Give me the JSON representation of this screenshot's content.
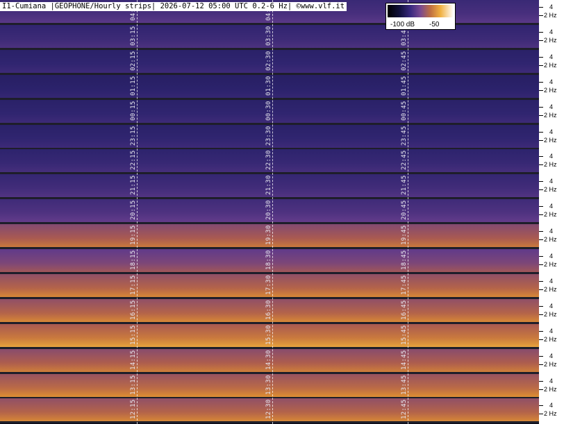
{
  "title": "I1-Cumiana |GEOPHONE/Hourly strips| 2026-07-12 05:00 UTC 0.2-6 Hz| ©www.vlf.it",
  "legend": {
    "min_label": "-100 dB",
    "max_label": "-50",
    "colormap": [
      "#000000",
      "#10103a",
      "#3a2a80",
      "#7a4a90",
      "#c07040",
      "#f0b040",
      "#ffffff"
    ]
  },
  "chart_data": {
    "type": "heatmap",
    "title": "I1-Cumiana |GEOPHONE/Hourly strips| 2026-07-12 05:00 UTC 0.2-6 Hz| ©www.vlf.it",
    "frequency_range_hz": [
      0.2,
      6
    ],
    "y_tick_labels": [
      "4",
      "2 Hz"
    ],
    "color_scale_db": [
      -100,
      -50
    ],
    "strips": [
      {
        "labels": [
          "04:1",
          "04:",
          "04:"
        ],
        "intensity": 0.35
      },
      {
        "labels": [
          "03:15",
          "03:30",
          "03:45"
        ],
        "intensity": 0.3
      },
      {
        "labels": [
          "02:15",
          "02:30",
          "02:45"
        ],
        "intensity": 0.25
      },
      {
        "labels": [
          "01:15",
          "01:30",
          "01:45"
        ],
        "intensity": 0.22
      },
      {
        "labels": [
          "00:15",
          "00:30",
          "00:45"
        ],
        "intensity": 0.25
      },
      {
        "labels": [
          "23:15",
          "23:30",
          "23:45"
        ],
        "intensity": 0.25
      },
      {
        "labels": [
          "22:15",
          "22:30",
          "22:45"
        ],
        "intensity": 0.28
      },
      {
        "labels": [
          "21:15",
          "21:30",
          "21:45"
        ],
        "intensity": 0.32
      },
      {
        "labels": [
          "20:15",
          "20:30",
          "20:45"
        ],
        "intensity": 0.38
      },
      {
        "labels": [
          "19:15",
          "19:30",
          "19:45"
        ],
        "intensity": 0.7
      },
      {
        "labels": [
          "18:15",
          "18:30",
          "18:45"
        ],
        "intensity": 0.55
      },
      {
        "labels": [
          "17:15",
          "17:30",
          "17:45"
        ],
        "intensity": 0.75
      },
      {
        "labels": [
          "16:15",
          "16:30",
          "16:45"
        ],
        "intensity": 0.75
      },
      {
        "labels": [
          "15:15",
          "15:30",
          "15:45"
        ],
        "intensity": 0.85
      },
      {
        "labels": [
          "14:15",
          "14:30",
          "14:45"
        ],
        "intensity": 0.72
      },
      {
        "labels": [
          "13:15",
          "13:30",
          "13:45"
        ],
        "intensity": 0.78
      },
      {
        "labels": [
          "12:15",
          "12:30",
          "12:45"
        ],
        "intensity": 0.75
      }
    ]
  }
}
